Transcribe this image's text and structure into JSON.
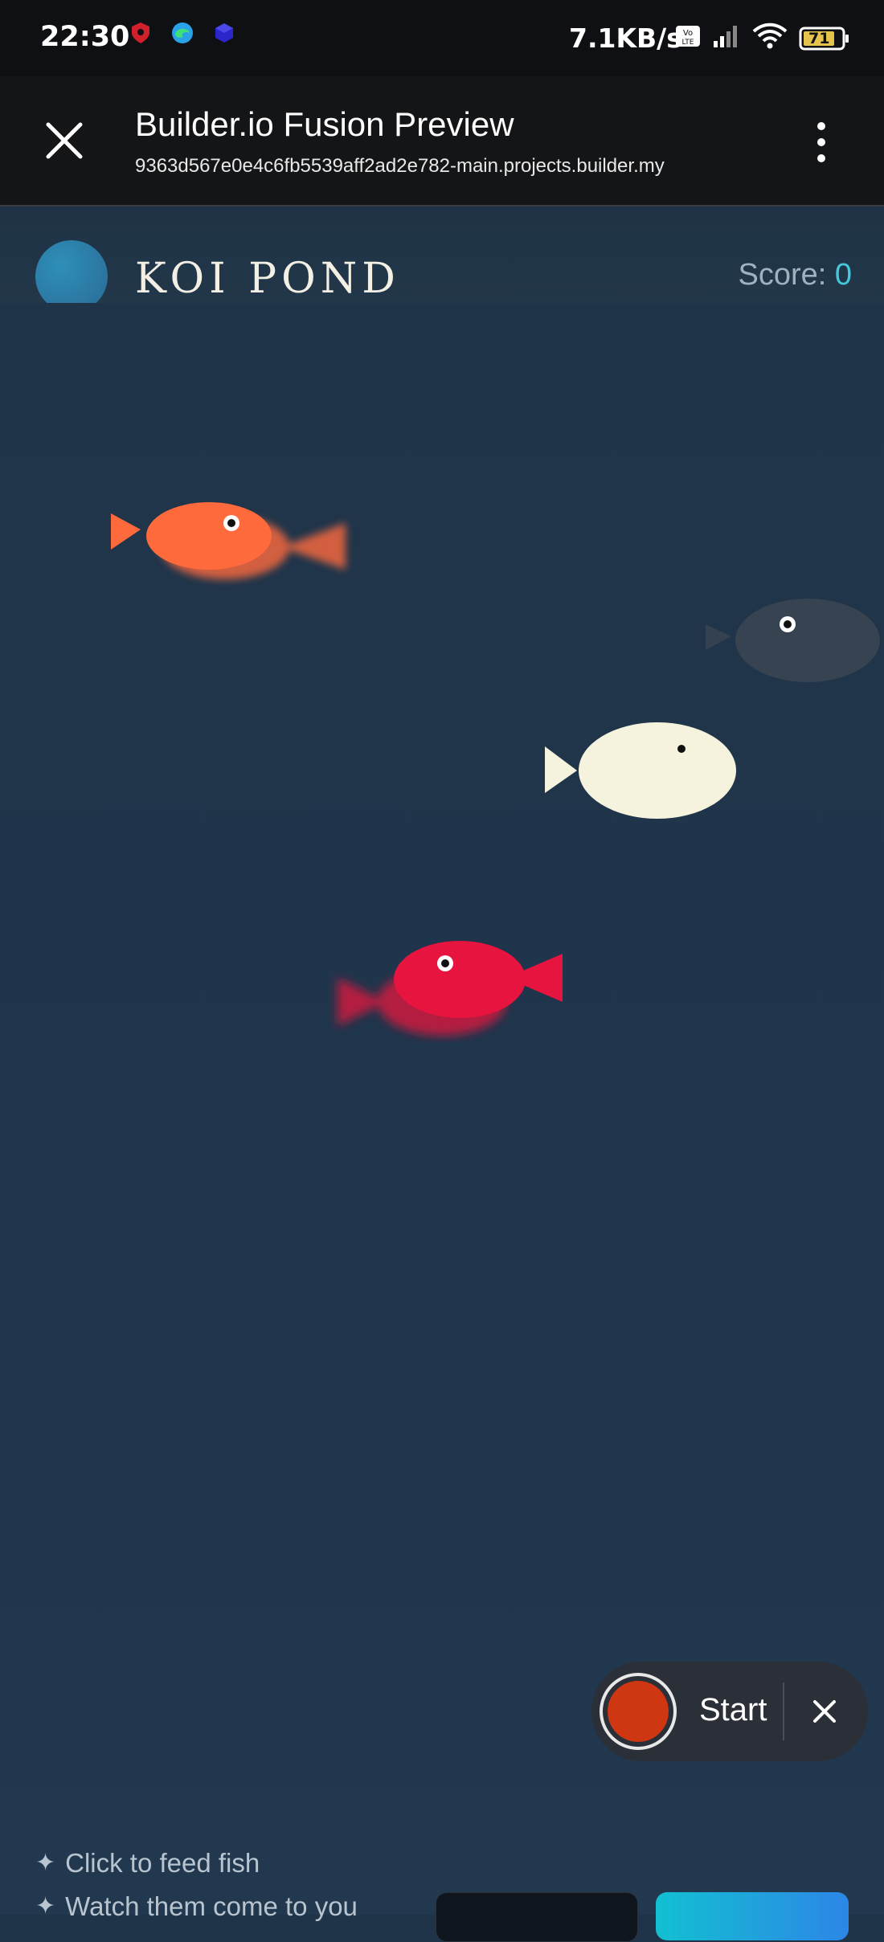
{
  "status_bar": {
    "time": "22:30",
    "net_speed": "7.1KB/s",
    "battery": "71",
    "icons": [
      "shield-icon",
      "edge-browser-icon",
      "cube-app-icon",
      "volte-icon",
      "signal-icon",
      "wifi-icon",
      "battery-icon"
    ]
  },
  "app_bar": {
    "title": "Builder.io Fusion Preview",
    "url": "9363d567e0e4c6fb5539aff2ad2e782-main.projects.builder.my"
  },
  "game": {
    "title": "KOI POND",
    "score_label": "Score: ",
    "score_value": "0"
  },
  "fish": [
    {
      "name": "orange-koi",
      "color": "#ff6a3c"
    },
    {
      "name": "grey-koi",
      "color": "#3d4753"
    },
    {
      "name": "white-koi",
      "color": "#f5f3dd"
    },
    {
      "name": "red-koi",
      "color": "#e6143e"
    }
  ],
  "recorder": {
    "start_label": "Start",
    "record_color": "#cf3612"
  },
  "tips": [
    "Click to feed fish",
    "Watch them come to you"
  ],
  "colors": {
    "pond": "#203449",
    "score_accent": "#46c9dc"
  }
}
